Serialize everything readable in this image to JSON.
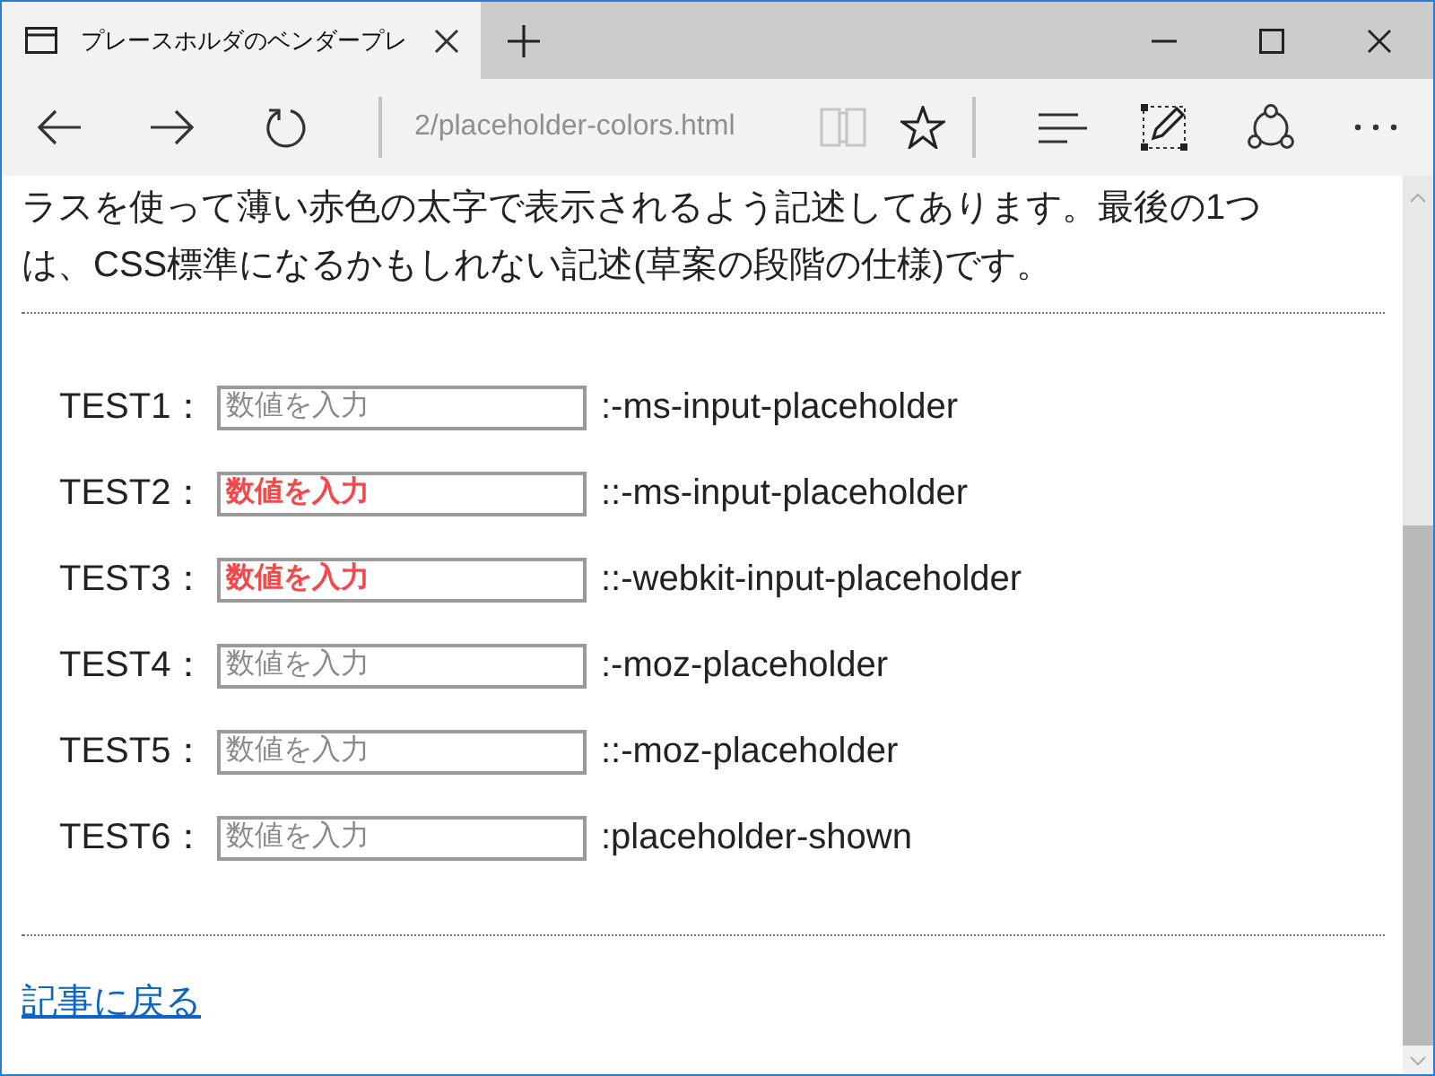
{
  "tab": {
    "title": "プレースホルダのベンダープレ",
    "selected": true
  },
  "toolbar": {
    "address": "2/placeholder-colors.html",
    "reading_view": {
      "disabled": true
    }
  },
  "article": {
    "paragraph_lines": [
      "ラスを使って薄い赤色の太字で表示されるよう記述してあります。最後の1つ",
      "は、CSS標準になるかもしれない記述(草案の段階の仕様)です。"
    ],
    "tests": [
      {
        "label": "TEST1：",
        "placeholder": "数値を入力",
        "styled": false,
        "selector": ":-ms-input-placeholder"
      },
      {
        "label": "TEST2：",
        "placeholder": "数値を入力",
        "styled": true,
        "selector": "::-ms-input-placeholder"
      },
      {
        "label": "TEST3：",
        "placeholder": "数値を入力",
        "styled": true,
        "selector": "::-webkit-input-placeholder"
      },
      {
        "label": "TEST4：",
        "placeholder": "数値を入力",
        "styled": false,
        "selector": ":-moz-placeholder"
      },
      {
        "label": "TEST5：",
        "placeholder": "数値を入力",
        "styled": false,
        "selector": "::-moz-placeholder"
      },
      {
        "label": "TEST6：",
        "placeholder": "数値を入力",
        "styled": false,
        "selector": ":placeholder-shown"
      }
    ],
    "back_link": "記事に戻る"
  }
}
